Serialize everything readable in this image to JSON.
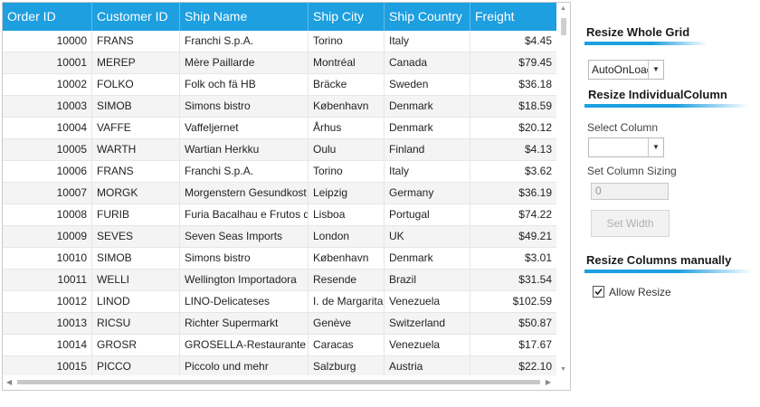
{
  "grid": {
    "columns": [
      "Order ID",
      "Customer ID",
      "Ship Name",
      "Ship City",
      "Ship Country",
      "Freight"
    ],
    "rows": [
      [
        "10000",
        "FRANS",
        "Franchi S.p.A.",
        "Torino",
        "Italy",
        "$4.45"
      ],
      [
        "10001",
        "MEREP",
        "Mère Paillarde",
        "Montréal",
        "Canada",
        "$79.45"
      ],
      [
        "10002",
        "FOLKO",
        "Folk och fä HB",
        "Bräcke",
        "Sweden",
        "$36.18"
      ],
      [
        "10003",
        "SIMOB",
        "Simons bistro",
        "København",
        "Denmark",
        "$18.59"
      ],
      [
        "10004",
        "VAFFE",
        "Vaffeljernet",
        "Århus",
        "Denmark",
        "$20.12"
      ],
      [
        "10005",
        "WARTH",
        "Wartian Herkku",
        "Oulu",
        "Finland",
        "$4.13"
      ],
      [
        "10006",
        "FRANS",
        "Franchi S.p.A.",
        "Torino",
        "Italy",
        "$3.62"
      ],
      [
        "10007",
        "MORGK",
        "Morgenstern Gesundkost",
        "Leipzig",
        "Germany",
        "$36.19"
      ],
      [
        "10008",
        "FURIB",
        "Furia Bacalhau e Frutos do Mar",
        "Lisboa",
        "Portugal",
        "$74.22"
      ],
      [
        "10009",
        "SEVES",
        "Seven Seas Imports",
        "London",
        "UK",
        "$49.21"
      ],
      [
        "10010",
        "SIMOB",
        "Simons bistro",
        "København",
        "Denmark",
        "$3.01"
      ],
      [
        "10011",
        "WELLI",
        "Wellington Importadora",
        "Resende",
        "Brazil",
        "$31.54"
      ],
      [
        "10012",
        "LINOD",
        "LINO-Delicateses",
        "I. de Margarita",
        "Venezuela",
        "$102.59"
      ],
      [
        "10013",
        "RICSU",
        "Richter Supermarkt",
        "Genève",
        "Switzerland",
        "$50.87"
      ],
      [
        "10014",
        "GROSR",
        "GROSELLA-Restaurante",
        "Caracas",
        "Venezuela",
        "$17.67"
      ],
      [
        "10015",
        "PICCO",
        "Piccolo und mehr",
        "Salzburg",
        "Austria",
        "$22.10"
      ]
    ]
  },
  "panel": {
    "resize_whole_grid_title": "Resize Whole Grid",
    "whole_grid_mode": "AutoOnLoad",
    "resize_individual_title": "Resize IndividualColumn",
    "select_column_label": "Select Column",
    "select_column_value": "",
    "set_column_sizing_label": "Set Column Sizing",
    "column_sizing_value": "0",
    "set_width_button": "Set Width",
    "resize_manual_title": "Resize Columns manually",
    "allow_resize_label": "Allow Resize",
    "allow_resize_checked": true
  },
  "colors": {
    "header_bg": "#1d9fe0",
    "accent": "#1d9fe0"
  },
  "icons": [
    "chevron-down-icon",
    "checkmark-icon",
    "scroll-up-arrow-icon",
    "scroll-down-arrow-icon",
    "scroll-left-arrow-icon",
    "scroll-right-arrow-icon"
  ]
}
